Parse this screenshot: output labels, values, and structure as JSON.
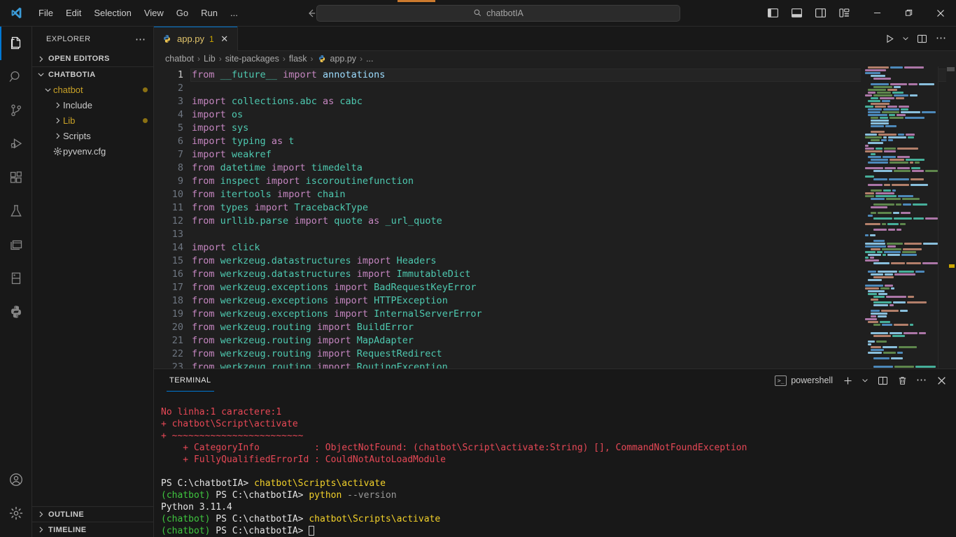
{
  "window": {
    "titlebar_search": "chatbotIA",
    "search_icon": "search-icon",
    "menu": [
      "File",
      "Edit",
      "Selection",
      "View",
      "Go",
      "Run",
      "..."
    ],
    "nav_back": "back-arrow-icon",
    "nav_forward": "forward-arrow-icon",
    "layout_buttons": [
      "toggle-primary-sidebar-icon",
      "toggle-panel-icon",
      "toggle-secondary-sidebar-icon",
      "customize-layout-icon"
    ],
    "window_controls": {
      "minimize": "─",
      "maximize": "❐",
      "close": "✕"
    }
  },
  "activity_bar": {
    "items": [
      {
        "name": "explorer",
        "icon": "files-icon",
        "active": true
      },
      {
        "name": "search",
        "icon": "search-icon",
        "active": false
      },
      {
        "name": "source-control",
        "icon": "source-control-icon",
        "active": false
      },
      {
        "name": "run-and-debug",
        "icon": "run-debug-icon",
        "active": false
      },
      {
        "name": "extensions",
        "icon": "extensions-icon",
        "active": false
      },
      {
        "name": "testing",
        "icon": "beaker-icon",
        "active": false
      },
      {
        "name": "remote-explorer",
        "icon": "windows-stack-icon",
        "active": false
      },
      {
        "name": "database",
        "icon": "database-icon",
        "active": false
      },
      {
        "name": "python",
        "icon": "python-icon",
        "active": false
      }
    ],
    "bottom": [
      {
        "name": "accounts",
        "icon": "account-icon"
      },
      {
        "name": "manage-settings",
        "icon": "gear-icon"
      }
    ]
  },
  "sidebar": {
    "title": "EXPLORER",
    "more_actions": "⋯",
    "sections": [
      {
        "label": "OPEN EDITORS",
        "expanded": false
      },
      {
        "label": "CHATBOTIA",
        "expanded": true
      }
    ],
    "tree": [
      {
        "label": "chatbot",
        "indent": 1,
        "type": "folder",
        "expanded": true,
        "modified": true,
        "icon": "chevron-down-icon"
      },
      {
        "label": "Include",
        "indent": 2,
        "type": "folder",
        "expanded": false,
        "modified": false,
        "icon": "chevron-right-icon"
      },
      {
        "label": "Lib",
        "indent": 2,
        "type": "folder",
        "expanded": false,
        "modified": true,
        "icon": "chevron-right-icon"
      },
      {
        "label": "Scripts",
        "indent": 2,
        "type": "folder",
        "expanded": false,
        "modified": false,
        "icon": "chevron-right-icon"
      },
      {
        "label": "pyvenv.cfg",
        "indent": 2,
        "type": "file",
        "expanded": false,
        "modified": false,
        "icon": "gear-file-icon"
      }
    ],
    "bottom_sections": [
      {
        "label": "OUTLINE",
        "expanded": false
      },
      {
        "label": "TIMELINE",
        "expanded": false
      }
    ]
  },
  "editor": {
    "tab": {
      "filename": "app.py",
      "badge": "1",
      "close": "✕",
      "icon": "python-file-icon"
    },
    "actions": [
      "run-python-file-icon",
      "run-chevron-icon",
      "split-editor-icon",
      "more-actions-icon"
    ],
    "breadcrumb": [
      "chatbot",
      "Lib",
      "site-packages",
      "flask",
      "app.py",
      "..."
    ],
    "breadcrumb_file_icon": "python-file-icon",
    "current_line": 1,
    "lines": [
      {
        "n": 1,
        "tokens": [
          [
            "kw",
            "from"
          ],
          [
            "pln",
            " "
          ],
          [
            "mod2",
            "__future__"
          ],
          [
            "pln",
            " "
          ],
          [
            "kw",
            "import"
          ],
          [
            "pln",
            " "
          ],
          [
            "idn",
            "annotations"
          ]
        ]
      },
      {
        "n": 2,
        "tokens": []
      },
      {
        "n": 3,
        "tokens": [
          [
            "kw",
            "import"
          ],
          [
            "pln",
            " "
          ],
          [
            "mod2",
            "collections.abc"
          ],
          [
            "pln",
            " "
          ],
          [
            "kw",
            "as"
          ],
          [
            "pln",
            " "
          ],
          [
            "mod2",
            "cabc"
          ]
        ]
      },
      {
        "n": 4,
        "tokens": [
          [
            "kw",
            "import"
          ],
          [
            "pln",
            " "
          ],
          [
            "mod2",
            "os"
          ]
        ]
      },
      {
        "n": 5,
        "tokens": [
          [
            "kw",
            "import"
          ],
          [
            "pln",
            " "
          ],
          [
            "mod2",
            "sys"
          ]
        ]
      },
      {
        "n": 6,
        "tokens": [
          [
            "kw",
            "import"
          ],
          [
            "pln",
            " "
          ],
          [
            "mod2",
            "typing"
          ],
          [
            "pln",
            " "
          ],
          [
            "kw",
            "as"
          ],
          [
            "pln",
            " "
          ],
          [
            "mod2",
            "t"
          ]
        ]
      },
      {
        "n": 7,
        "tokens": [
          [
            "kw",
            "import"
          ],
          [
            "pln",
            " "
          ],
          [
            "mod2",
            "weakref"
          ]
        ]
      },
      {
        "n": 8,
        "tokens": [
          [
            "kw",
            "from"
          ],
          [
            "pln",
            " "
          ],
          [
            "mod2",
            "datetime"
          ],
          [
            "pln",
            " "
          ],
          [
            "kw",
            "import"
          ],
          [
            "pln",
            " "
          ],
          [
            "mod2",
            "timedelta"
          ]
        ]
      },
      {
        "n": 9,
        "tokens": [
          [
            "kw",
            "from"
          ],
          [
            "pln",
            " "
          ],
          [
            "mod2",
            "inspect"
          ],
          [
            "pln",
            " "
          ],
          [
            "kw",
            "import"
          ],
          [
            "pln",
            " "
          ],
          [
            "mod2",
            "iscoroutinefunction"
          ]
        ]
      },
      {
        "n": 10,
        "tokens": [
          [
            "kw",
            "from"
          ],
          [
            "pln",
            " "
          ],
          [
            "mod2",
            "itertools"
          ],
          [
            "pln",
            " "
          ],
          [
            "kw",
            "import"
          ],
          [
            "pln",
            " "
          ],
          [
            "mod2",
            "chain"
          ]
        ]
      },
      {
        "n": 11,
        "tokens": [
          [
            "kw",
            "from"
          ],
          [
            "pln",
            " "
          ],
          [
            "mod2",
            "types"
          ],
          [
            "pln",
            " "
          ],
          [
            "kw",
            "import"
          ],
          [
            "pln",
            " "
          ],
          [
            "mod2",
            "TracebackType"
          ]
        ]
      },
      {
        "n": 12,
        "tokens": [
          [
            "kw",
            "from"
          ],
          [
            "pln",
            " "
          ],
          [
            "mod2",
            "urllib.parse"
          ],
          [
            "pln",
            " "
          ],
          [
            "kw",
            "import"
          ],
          [
            "pln",
            " "
          ],
          [
            "mod2",
            "quote"
          ],
          [
            "pln",
            " "
          ],
          [
            "kw",
            "as"
          ],
          [
            "pln",
            " "
          ],
          [
            "mod2",
            "_url_quote"
          ]
        ]
      },
      {
        "n": 13,
        "tokens": []
      },
      {
        "n": 14,
        "tokens": [
          [
            "kw",
            "import"
          ],
          [
            "pln",
            " "
          ],
          [
            "mod2",
            "click"
          ]
        ]
      },
      {
        "n": 15,
        "tokens": [
          [
            "kw",
            "from"
          ],
          [
            "pln",
            " "
          ],
          [
            "mod2",
            "werkzeug.datastructures"
          ],
          [
            "pln",
            " "
          ],
          [
            "kw",
            "import"
          ],
          [
            "pln",
            " "
          ],
          [
            "mod2",
            "Headers"
          ]
        ]
      },
      {
        "n": 16,
        "tokens": [
          [
            "kw",
            "from"
          ],
          [
            "pln",
            " "
          ],
          [
            "mod2",
            "werkzeug.datastructures"
          ],
          [
            "pln",
            " "
          ],
          [
            "kw",
            "import"
          ],
          [
            "pln",
            " "
          ],
          [
            "mod2",
            "ImmutableDict"
          ]
        ]
      },
      {
        "n": 17,
        "tokens": [
          [
            "kw",
            "from"
          ],
          [
            "pln",
            " "
          ],
          [
            "mod2",
            "werkzeug.exceptions"
          ],
          [
            "pln",
            " "
          ],
          [
            "kw",
            "import"
          ],
          [
            "pln",
            " "
          ],
          [
            "mod2",
            "BadRequestKeyError"
          ]
        ]
      },
      {
        "n": 18,
        "tokens": [
          [
            "kw",
            "from"
          ],
          [
            "pln",
            " "
          ],
          [
            "mod2",
            "werkzeug.exceptions"
          ],
          [
            "pln",
            " "
          ],
          [
            "kw",
            "import"
          ],
          [
            "pln",
            " "
          ],
          [
            "mod2",
            "HTTPException"
          ]
        ]
      },
      {
        "n": 19,
        "tokens": [
          [
            "kw",
            "from"
          ],
          [
            "pln",
            " "
          ],
          [
            "mod2",
            "werkzeug.exceptions"
          ],
          [
            "pln",
            " "
          ],
          [
            "kw",
            "import"
          ],
          [
            "pln",
            " "
          ],
          [
            "mod2",
            "InternalServerError"
          ]
        ]
      },
      {
        "n": 20,
        "tokens": [
          [
            "kw",
            "from"
          ],
          [
            "pln",
            " "
          ],
          [
            "mod2",
            "werkzeug.routing"
          ],
          [
            "pln",
            " "
          ],
          [
            "kw",
            "import"
          ],
          [
            "pln",
            " "
          ],
          [
            "mod2",
            "BuildError"
          ]
        ]
      },
      {
        "n": 21,
        "tokens": [
          [
            "kw",
            "from"
          ],
          [
            "pln",
            " "
          ],
          [
            "mod2",
            "werkzeug.routing"
          ],
          [
            "pln",
            " "
          ],
          [
            "kw",
            "import"
          ],
          [
            "pln",
            " "
          ],
          [
            "mod2",
            "MapAdapter"
          ]
        ]
      },
      {
        "n": 22,
        "tokens": [
          [
            "kw",
            "from"
          ],
          [
            "pln",
            " "
          ],
          [
            "mod2",
            "werkzeug.routing"
          ],
          [
            "pln",
            " "
          ],
          [
            "kw",
            "import"
          ],
          [
            "pln",
            " "
          ],
          [
            "mod2",
            "RequestRedirect"
          ]
        ]
      },
      {
        "n": 23,
        "tokens": [
          [
            "kw",
            "from"
          ],
          [
            "pln",
            " "
          ],
          [
            "mod2",
            "werkzeug.routing"
          ],
          [
            "pln",
            " "
          ],
          [
            "kw",
            "import"
          ],
          [
            "pln",
            " "
          ],
          [
            "mod2",
            "RoutingException"
          ]
        ]
      }
    ],
    "scrollbar": {
      "warning_marker_color": "#cca700"
    }
  },
  "panel": {
    "tabs": [
      {
        "label": "TERMINAL",
        "active": true
      }
    ],
    "shell": "powershell",
    "shell_icon": "terminal-icon",
    "actions": [
      "new-terminal-icon",
      "terminal-profile-chevron-icon",
      "split-terminal-icon",
      "kill-terminal-icon",
      "more-actions-icon",
      "close-panel-icon"
    ],
    "terminal_lines": [
      {
        "segments": []
      },
      {
        "segments": [
          [
            "t-err",
            "No linha:1 caractere:1"
          ]
        ]
      },
      {
        "segments": [
          [
            "t-err",
            "+ chatbot\\Script\\activate"
          ]
        ]
      },
      {
        "segments": [
          [
            "t-err",
            "+ ~~~~~~~~~~~~~~~~~~~~~~~~"
          ]
        ]
      },
      {
        "segments": [
          [
            "t-err",
            "    + CategoryInfo          : ObjectNotFound: (chatbot\\Script\\activate:String) [], CommandNotFoundException"
          ]
        ]
      },
      {
        "segments": [
          [
            "t-err",
            "    + FullyQualifiedErrorId : CouldNotAutoLoadModule"
          ]
        ]
      },
      {
        "segments": []
      },
      {
        "segments": [
          [
            "t-white",
            "PS C:\\chatbotIA> "
          ],
          [
            "t-yellow",
            "chatbot\\Scripts\\activate"
          ]
        ]
      },
      {
        "segments": [
          [
            "t-green",
            "(chatbot)"
          ],
          [
            "t-white",
            " PS C:\\chatbotIA> "
          ],
          [
            "t-yellow",
            "python "
          ],
          [
            "t-gray",
            "--version"
          ]
        ]
      },
      {
        "segments": [
          [
            "t-white",
            "Python 3.11.4"
          ]
        ]
      },
      {
        "segments": [
          [
            "t-green",
            "(chatbot)"
          ],
          [
            "t-white",
            " PS C:\\chatbotIA> "
          ],
          [
            "t-yellow",
            "chatbot\\Scripts\\activate"
          ]
        ]
      },
      {
        "segments": [
          [
            "t-green",
            "(chatbot)"
          ],
          [
            "t-white",
            " PS C:\\chatbotIA> "
          ],
          [
            "cursor",
            "▊"
          ]
        ]
      }
    ]
  },
  "theme": {
    "background": "#1e1e1e",
    "editor_background": "#1f1f1f",
    "chrome_background": "#181818",
    "accent": "#0078d4",
    "keyword": "#c586c0",
    "module": "#4ec9b0",
    "identifier": "#9cdcfe",
    "error_red": "#e74856",
    "prompt_green": "#3fc63f",
    "command_yellow": "#f2d12a",
    "modified_yellow": "#c9a227",
    "orange_accent": "#cc7a2e"
  }
}
